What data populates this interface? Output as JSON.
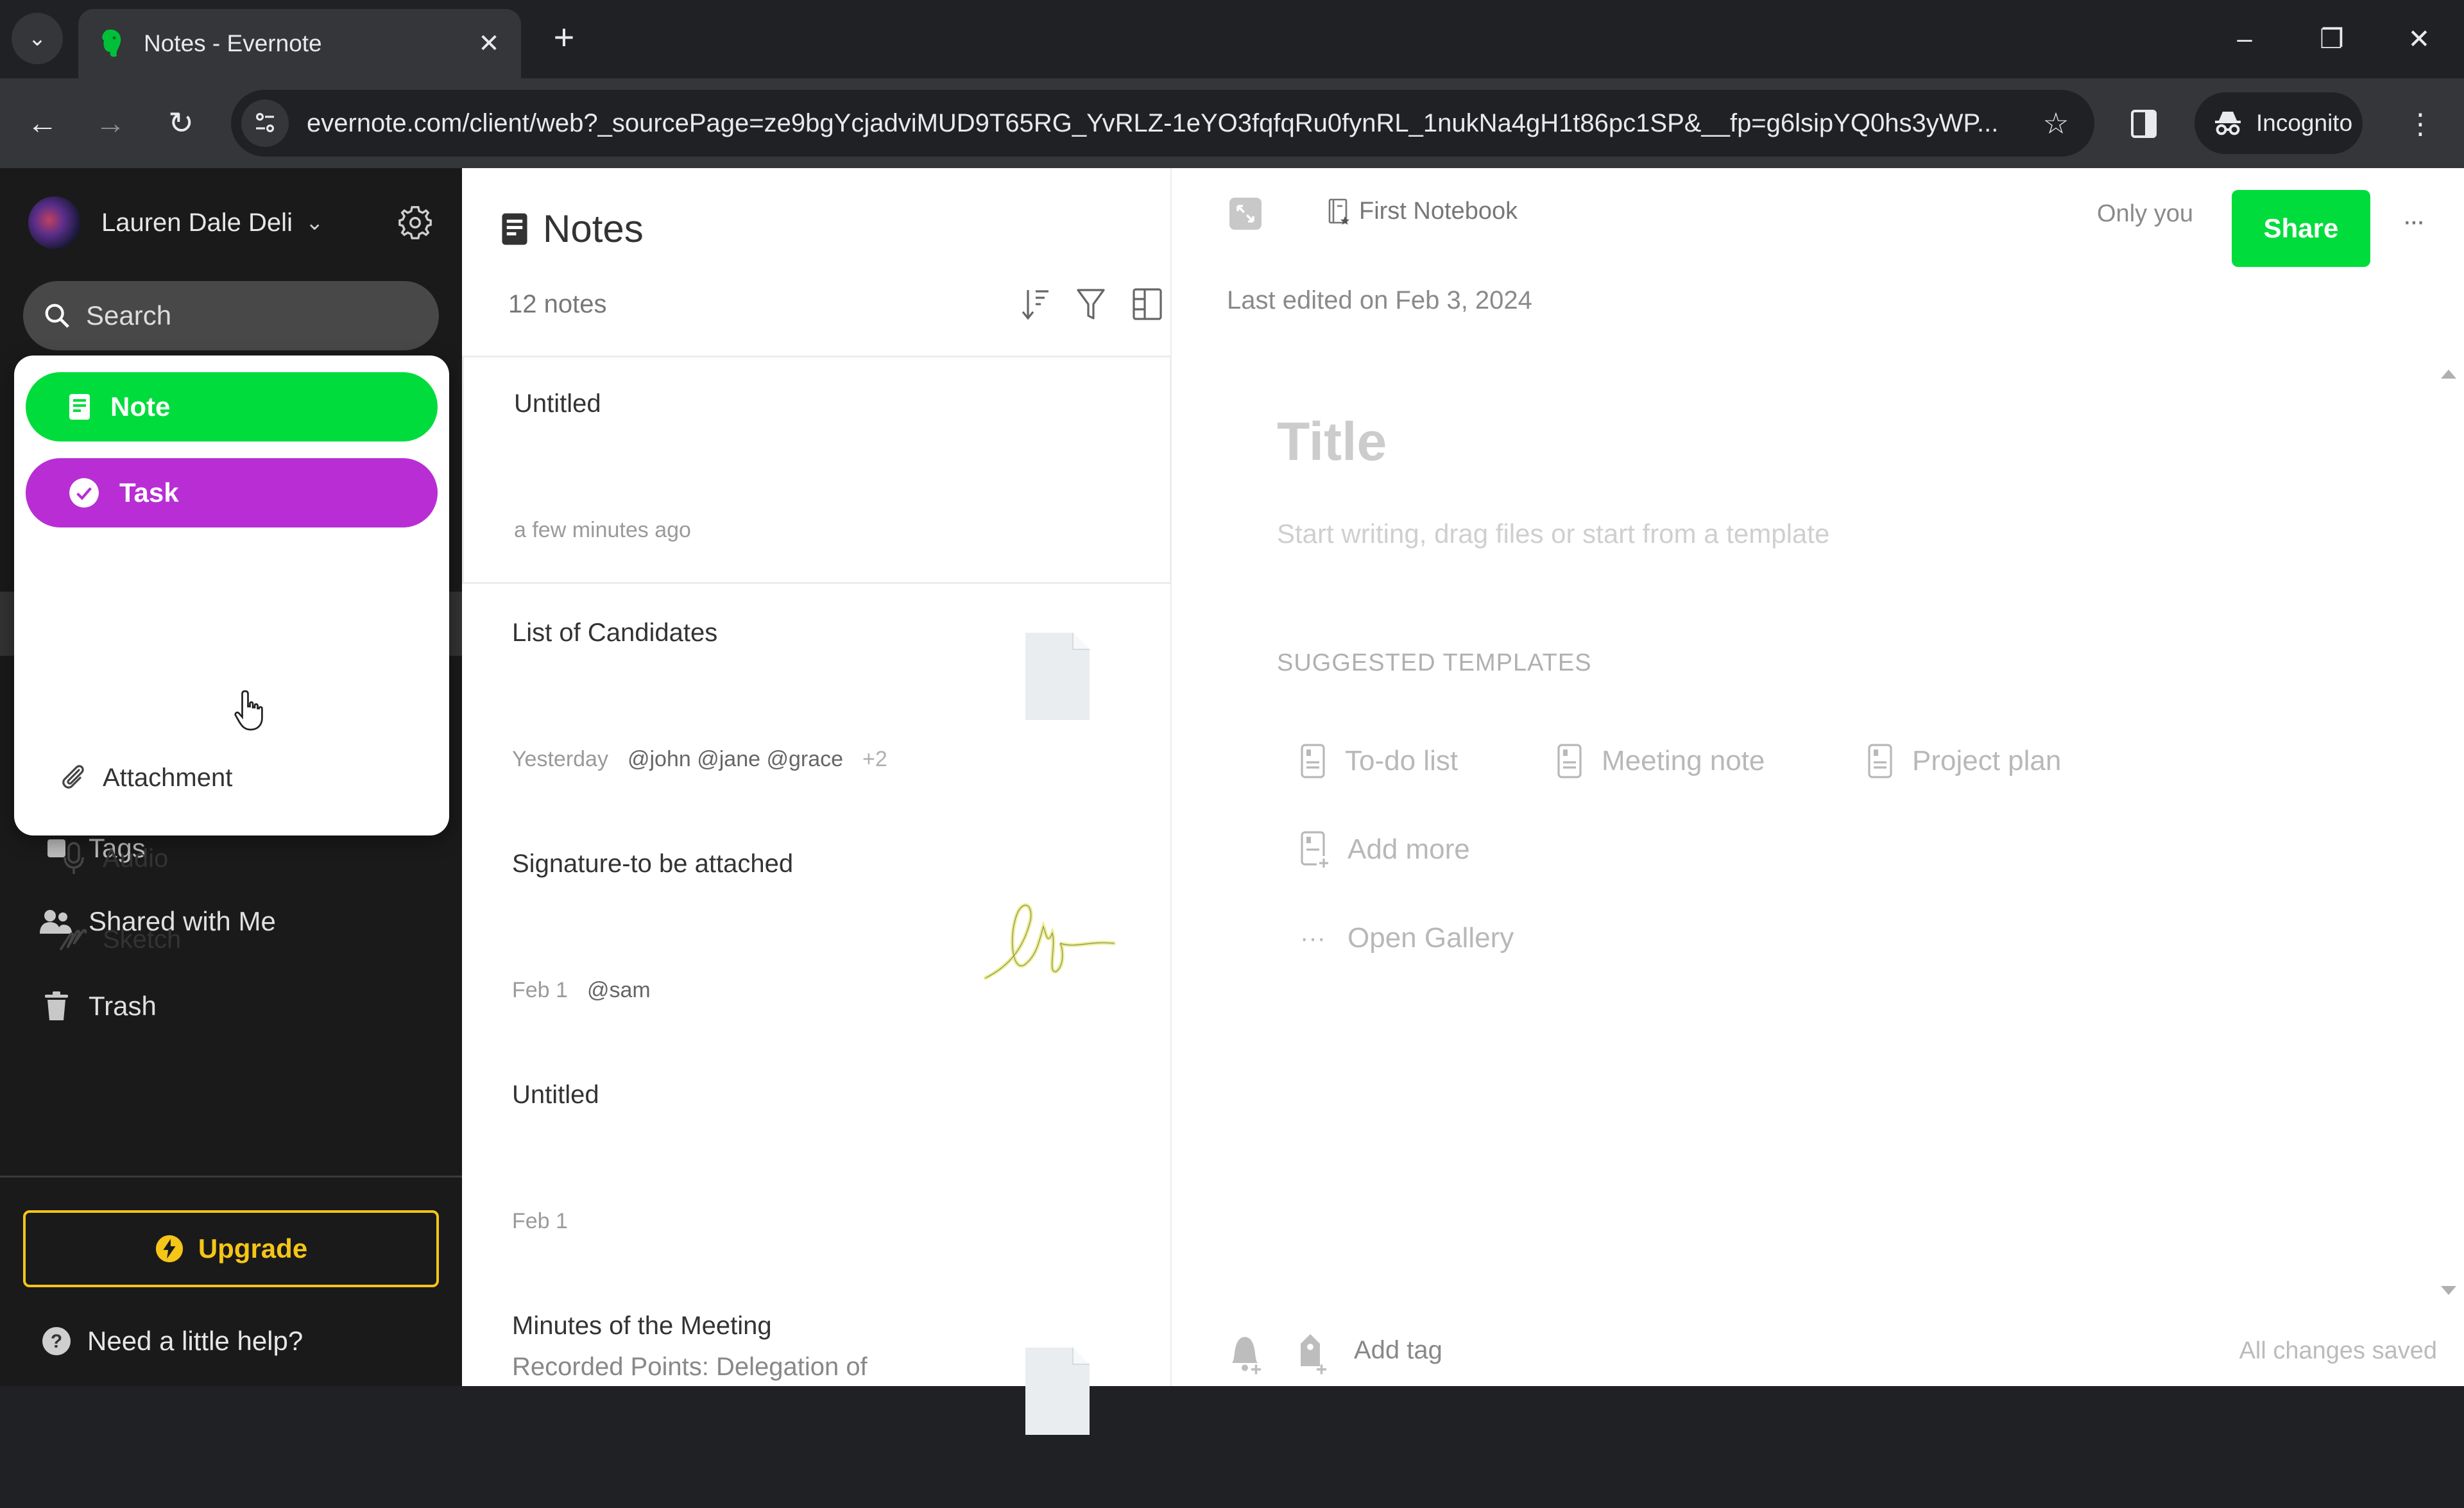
{
  "browser": {
    "tab_title": "Notes - Evernote",
    "url": "evernote.com/client/web?_sourcePage=ze9bgYcjadviMUD9T65RG_YvRLZ-1eYO3fqfqRu0fynRL_1nukNa4gH1t86pc1SP&__fp=g6lsipYQ0hs3yWP...",
    "incognito_label": "Incognito",
    "icons": {
      "tab_menu": "chevron-down-icon",
      "favicon": "evernote-elephant-icon",
      "close": "close-icon",
      "new_tab": "plus-icon",
      "back": "arrow-left-icon",
      "forward": "arrow-right-icon",
      "reload": "reload-icon",
      "site_info": "tune-icon",
      "bookmark": "star-icon",
      "side_panel": "side-panel-icon",
      "incognito": "incognito-icon",
      "menu": "kebab-icon"
    },
    "glyphs": {
      "tab_menu": "⌄",
      "close": "✕",
      "new_tab": "+",
      "back": "←",
      "forward": "→",
      "reload": "↻",
      "bookmark": "☆",
      "minimize": "–",
      "restore": "❐",
      "window_close": "✕",
      "menu": "⋮"
    }
  },
  "sidebar": {
    "user_name": "Lauren Dale Deli",
    "search_placeholder": "Search",
    "items": [
      {
        "label": "Tags",
        "icon": "tag-icon"
      },
      {
        "label": "Shared with Me",
        "icon": "people-icon"
      },
      {
        "label": "Trash",
        "icon": "trash-icon"
      }
    ],
    "upgrade_label": "Upgrade",
    "help_label": "Need a little help?",
    "colors": {
      "upgrade": "#f5c518",
      "background": "#1a1a1a"
    }
  },
  "new_menu": {
    "primary": [
      {
        "label": "Note",
        "icon": "note-icon",
        "color": "#00dc3c"
      },
      {
        "label": "Task",
        "icon": "check-circle-icon",
        "color": "#b82ed4"
      }
    ],
    "items": [
      {
        "label": "Attachment",
        "icon": "paperclip-icon"
      },
      {
        "label": "Audio",
        "icon": "microphone-icon"
      },
      {
        "label": "Sketch",
        "icon": "sketch-icon"
      }
    ]
  },
  "note_list": {
    "title": "Notes",
    "count_label": "12 notes",
    "tools": [
      "sort-icon",
      "filter-icon",
      "view-layout-icon"
    ],
    "notes": [
      {
        "title": "Untitled",
        "snippet": "",
        "date": "a few minutes ago",
        "mentions": "",
        "more": "",
        "thumb": "none"
      },
      {
        "title": "List of Candidates",
        "snippet": "",
        "date": "Yesterday",
        "mentions": "@john @jane @grace",
        "more": "+2",
        "thumb": "file"
      },
      {
        "title": "Signature-to be attached",
        "snippet": "",
        "date": "Feb 1",
        "mentions": "@sam",
        "more": "",
        "thumb": "signature"
      },
      {
        "title": "Untitled",
        "snippet": "",
        "date": "Feb 1",
        "mentions": "",
        "more": "",
        "thumb": "none"
      },
      {
        "title": "Minutes of the Meeting",
        "snippet": "Recorded Points: Delegation of",
        "date": "",
        "mentions": "",
        "more": "",
        "thumb": "file"
      }
    ]
  },
  "editor": {
    "notebook": "First Notebook",
    "share_scope": "Only you",
    "share_label": "Share",
    "more_label": "···",
    "last_edited": "Last edited on Feb 3, 2024",
    "title_placeholder": "Title",
    "body_placeholder": "Start writing, drag files or start from a template",
    "suggested_label": "SUGGESTED TEMPLATES",
    "templates": [
      "To-do list",
      "Meeting note",
      "Project plan"
    ],
    "add_more": "Add more",
    "open_gallery": "Open Gallery",
    "add_tag": "Add tag",
    "save_status": "All changes saved",
    "colors": {
      "share": "#00dc3c"
    }
  }
}
